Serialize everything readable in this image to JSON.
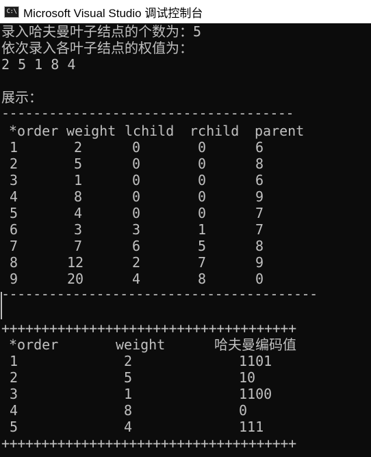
{
  "window": {
    "title": "Microsoft Visual Studio 调试控制台",
    "icon": "console-app-icon",
    "icon_text": "C:\\"
  },
  "console": {
    "prompt_count": "录入哈夫曼叶子结点的个数为：5",
    "prompt_weights": "依次录入各叶子结点的权值为：",
    "weights_input": "2 5 1 8 4",
    "show_label": "展示：",
    "divider_top": "-------------------------------------",
    "tree_headers": [
      "*order",
      "weight",
      "lchild",
      "rchild",
      "parent"
    ],
    "tree_rows": [
      [
        "1",
        "2",
        "0",
        "0",
        "6"
      ],
      [
        "2",
        "5",
        "0",
        "0",
        "8"
      ],
      [
        "3",
        "1",
        "0",
        "0",
        "6"
      ],
      [
        "4",
        "8",
        "0",
        "0",
        "9"
      ],
      [
        "5",
        "4",
        "0",
        "0",
        "7"
      ],
      [
        "6",
        "3",
        "3",
        "1",
        "7"
      ],
      [
        "7",
        "7",
        "6",
        "5",
        "8"
      ],
      [
        "8",
        "12",
        "2",
        "7",
        "9"
      ],
      [
        "9",
        "20",
        "4",
        "8",
        "0"
      ]
    ],
    "divider_bottom": "----------------------------------------",
    "plus_line": "+++++++++++++++++++++++++++++++++++++",
    "code_headers": [
      "*order",
      "weight",
      "哈夫曼编码值"
    ],
    "code_rows": [
      [
        "1",
        "2",
        "1101"
      ],
      [
        "2",
        "5",
        "10"
      ],
      [
        "3",
        "1",
        "1100"
      ],
      [
        "4",
        "8",
        "0"
      ],
      [
        "5",
        "4",
        "111"
      ]
    ]
  },
  "colors": {
    "background": "#0c0c0c",
    "text": "#c0c0c0",
    "titlebar": "#ffffff"
  }
}
